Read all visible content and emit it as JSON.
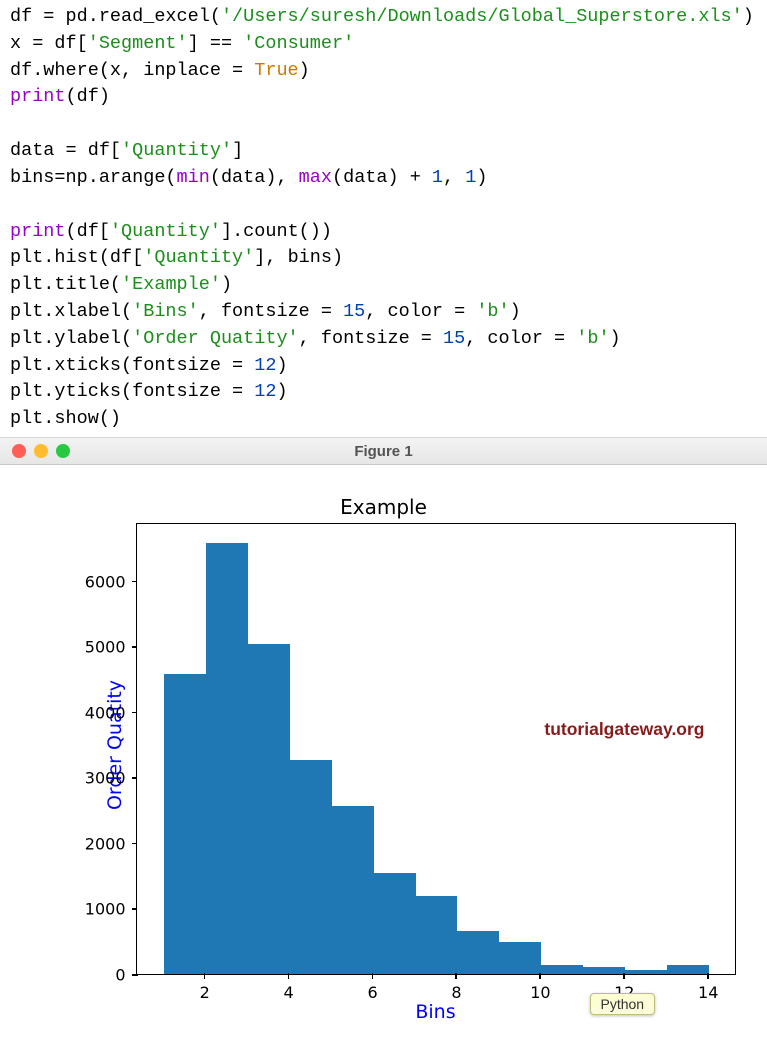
{
  "code": {
    "l1": {
      "a": "df = pd.read_excel(",
      "b": "'/Users/suresh/Downloads/Global_Superstore.xls'",
      "c": ")"
    },
    "l2": {
      "a": "x = df[",
      "b": "'Segment'",
      "c": "] == ",
      "d": "'Consumer'"
    },
    "l3": {
      "a": "df.where(x, inplace = ",
      "b": "True",
      "c": ")"
    },
    "l4": {
      "a": "print",
      "b": "(df)"
    },
    "l5": "",
    "l6": {
      "a": "data = df[",
      "b": "'Quantity'",
      "c": "]"
    },
    "l7": {
      "a": "bins=np.arange(",
      "b": "min",
      "c": "(data), ",
      "d": "max",
      "e": "(data) + ",
      "f": "1",
      "g": ", ",
      "h": "1",
      "i": ")"
    },
    "l8": "",
    "l9": {
      "a": "print",
      "b": "(df[",
      "c": "'Quantity'",
      "d": "].count())"
    },
    "l10": {
      "a": "plt.hist(df[",
      "b": "'Quantity'",
      "c": "], bins)"
    },
    "l11": {
      "a": "plt.title(",
      "b": "'Example'",
      "c": ")"
    },
    "l12": {
      "a": "plt.xlabel(",
      "b": "'Bins'",
      "c": ", fontsize = ",
      "d": "15",
      "e": ", color = ",
      "f": "'b'",
      "g": ")"
    },
    "l13": {
      "a": "plt.ylabel(",
      "b": "'Order Quatity'",
      "c": ", fontsize = ",
      "d": "15",
      "e": ", color = ",
      "f": "'b'",
      "g": ")"
    },
    "l14": {
      "a": "plt.xticks(fontsize = ",
      "b": "12",
      "c": ")"
    },
    "l15": {
      "a": "plt.yticks(fontsize = ",
      "b": "12",
      "c": ")"
    },
    "l16": "plt.show()"
  },
  "window": {
    "title": "Figure 1"
  },
  "chart_data": {
    "type": "bar",
    "title": "Example",
    "xlabel": "Bins",
    "ylabel": "Order Quatity",
    "bin_edges": [
      1,
      2,
      3,
      4,
      5,
      6,
      7,
      8,
      9,
      10,
      11,
      12,
      13,
      14
    ],
    "values": [
      4580,
      6580,
      5040,
      3270,
      2570,
      1540,
      1190,
      660,
      490,
      130,
      110,
      55,
      140
    ],
    "xlim": [
      0.35,
      14.65
    ],
    "ylim": [
      0,
      6900
    ],
    "x_ticks": [
      2,
      4,
      6,
      8,
      10,
      12,
      14
    ],
    "y_ticks": [
      0,
      1000,
      2000,
      3000,
      4000,
      5000,
      6000
    ],
    "x_tick_labels": [
      "2",
      "4",
      "6",
      "8",
      "10",
      "12",
      "14"
    ],
    "y_tick_labels": [
      "0",
      "1000",
      "2000",
      "3000",
      "4000",
      "5000",
      "6000"
    ],
    "watermark": "tutorialgateway.org",
    "tooltip": "Python"
  }
}
